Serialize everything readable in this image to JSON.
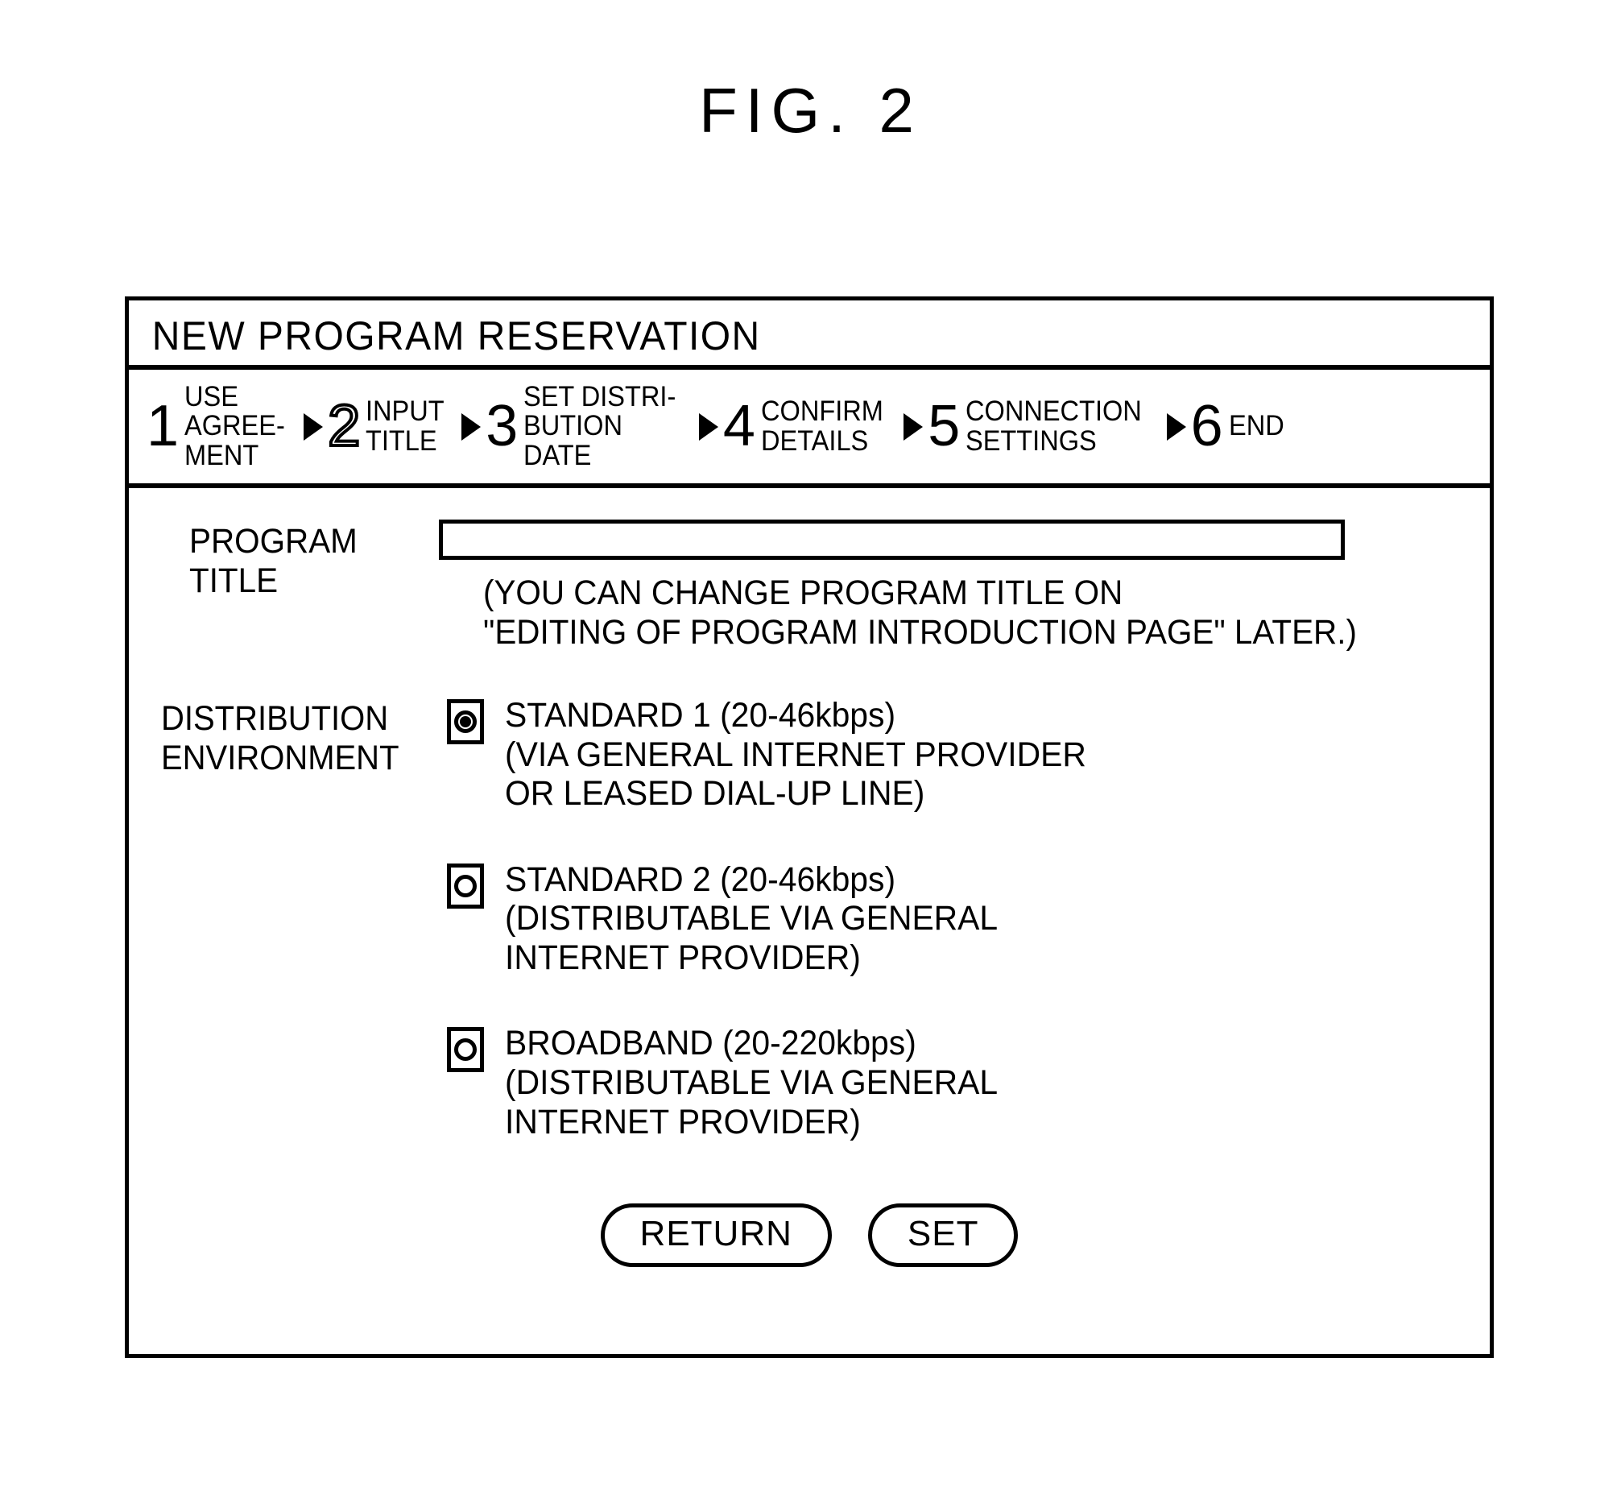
{
  "figure": {
    "caption": "FIG. 2"
  },
  "dialog": {
    "title": "NEW PROGRAM RESERVATION",
    "steps": [
      {
        "number": "1",
        "label": "USE\nAGREE-\nMENT",
        "current": false
      },
      {
        "number": "2",
        "label": "INPUT\nTITLE",
        "current": true
      },
      {
        "number": "3",
        "label": "SET DISTRI-\nBUTION\nDATE",
        "current": false
      },
      {
        "number": "4",
        "label": "CONFIRM\nDETAILS",
        "current": false
      },
      {
        "number": "5",
        "label": "CONNECTION\nSETTINGS",
        "current": false
      },
      {
        "number": "6",
        "label": "END",
        "current": false
      }
    ],
    "program_title": {
      "label": "PROGRAM\nTITLE",
      "value": "",
      "placeholder": "",
      "hint": "(YOU CAN CHANGE PROGRAM TITLE ON\n\"EDITING OF PROGRAM INTRODUCTION PAGE\" LATER.)"
    },
    "distribution_environment": {
      "label": "DISTRIBUTION\nENVIRONMENT",
      "options": [
        {
          "id": "standard-1",
          "text": "STANDARD 1 (20-46kbps)\n(VIA GENERAL INTERNET PROVIDER\n  OR LEASED DIAL-UP LINE)",
          "selected": true
        },
        {
          "id": "standard-2",
          "text": "STANDARD 2 (20-46kbps)\n(DISTRIBUTABLE VIA GENERAL\n  INTERNET PROVIDER)",
          "selected": false
        },
        {
          "id": "broadband",
          "text": "BROADBAND (20-220kbps)\n(DISTRIBUTABLE VIA GENERAL\n  INTERNET PROVIDER)",
          "selected": false
        }
      ]
    },
    "buttons": {
      "return_label": "RETURN",
      "set_label": "SET"
    }
  },
  "colors": {
    "ink": "#000000",
    "paper": "#ffffff"
  }
}
